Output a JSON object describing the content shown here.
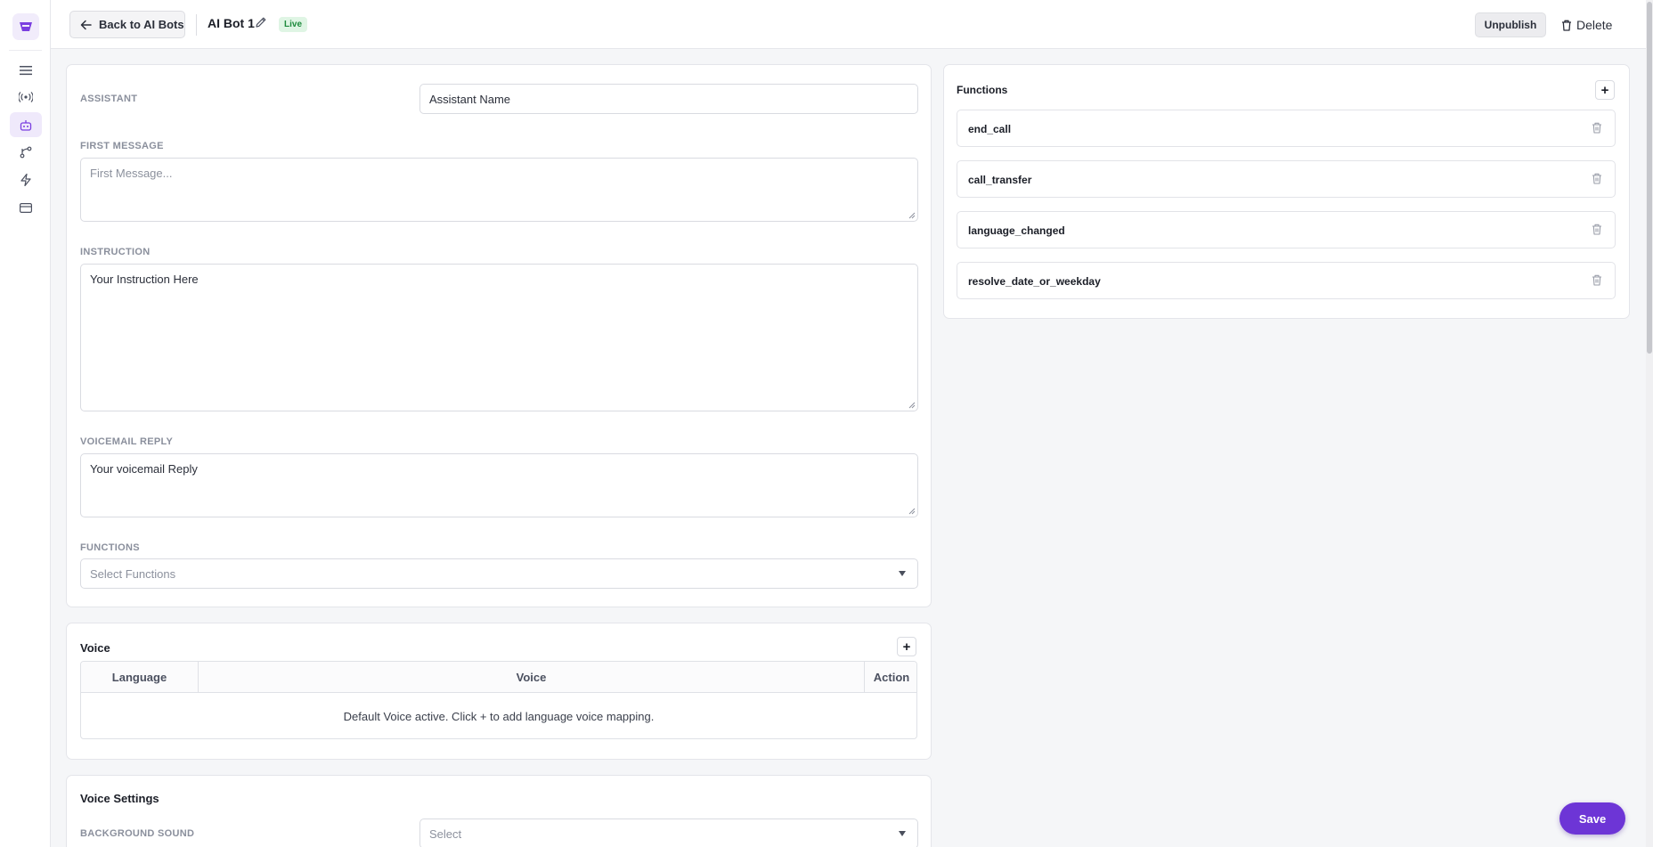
{
  "topbar": {
    "back_label": "Back to AI Bots",
    "bot_name": "AI Bot 1",
    "status_badge": "Live",
    "unpublish_label": "Unpublish",
    "delete_label": "Delete"
  },
  "assistant_card": {
    "assistant_label": "ASSISTANT",
    "assistant_name_value": "Assistant Name",
    "first_message_label": "FIRST MESSAGE",
    "first_message_placeholder": "First Message...",
    "instruction_label": "INSTRUCTION",
    "instruction_value": "Your Instruction Here",
    "voicemail_label": "VOICEMAIL REPLY",
    "voicemail_value": "Your voicemail Reply",
    "functions_label": "FUNCTIONS",
    "functions_placeholder": "Select Functions"
  },
  "voice_card": {
    "title": "Voice",
    "add_label": "+",
    "columns": [
      "Language",
      "Voice",
      "Action"
    ],
    "empty_message": "Default Voice active. Click + to add language voice mapping."
  },
  "voice_settings_card": {
    "title": "Voice Settings",
    "background_sound_label": "BACKGROUND SOUND",
    "background_sound_placeholder": "Select"
  },
  "functions_panel": {
    "title": "Functions",
    "add_label": "+",
    "items": [
      {
        "name": "end_call"
      },
      {
        "name": "call_transfer"
      },
      {
        "name": "language_changed"
      },
      {
        "name": "resolve_date_or_weekday"
      }
    ]
  },
  "save_label": "Save",
  "colors": {
    "accent": "#6d35d6",
    "live_bg": "#dff5e4",
    "live_text": "#1d8a3c"
  },
  "icons": {
    "logo": "app-logo-icon",
    "sidebar": [
      "menu-icon",
      "broadcast-icon",
      "bot-icon",
      "flow-icon",
      "lightning-icon",
      "card-icon"
    ]
  }
}
